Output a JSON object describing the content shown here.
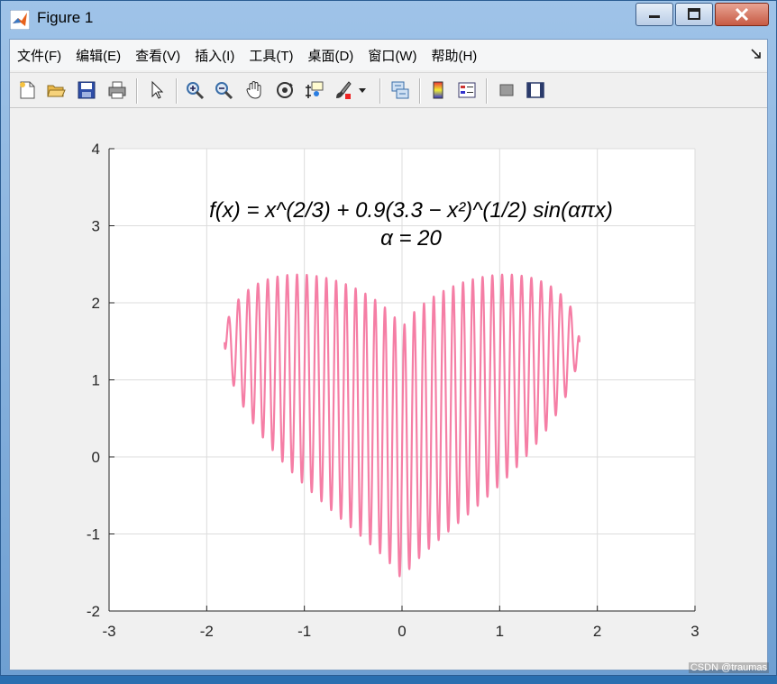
{
  "window": {
    "title": "Figure 1",
    "buttons": [
      "minimize-icon",
      "maximize-icon",
      "close-icon"
    ]
  },
  "menu": {
    "items": [
      "文件(F)",
      "编辑(E)",
      "查看(V)",
      "插入(I)",
      "工具(T)",
      "桌面(D)",
      "窗口(W)",
      "帮助(H)"
    ]
  },
  "toolbar": {
    "buttons": [
      "new-figure-icon",
      "open-file-icon",
      "save-icon",
      "print-icon",
      "pointer-icon",
      "zoom-in-icon",
      "zoom-out-icon",
      "pan-hand-icon",
      "rotate-3d-icon",
      "data-cursor-icon",
      "brush-icon",
      "link-plot-icon",
      "colorbar-icon",
      "legend-icon",
      "hide-plot-tools-icon",
      "show-plot-tools-icon"
    ]
  },
  "watermark": "CSDN @traumas",
  "chart_data": {
    "type": "line",
    "title_line1": "f(x) = x^(2/3) + 0.9(3.3 − x²)^(1/2) sin(απx)",
    "title_line2": "α = 20",
    "function": {
      "alpha": 20,
      "x_min": -1.8166,
      "x_max": 1.8166
    },
    "xlim": [
      -3,
      3
    ],
    "ylim": [
      -2,
      4
    ],
    "xticks": [
      "-3",
      "-2",
      "-1",
      "0",
      "1",
      "2",
      "3"
    ],
    "yticks": [
      "-2",
      "-1",
      "0",
      "1",
      "2",
      "3",
      "4"
    ],
    "grid": true,
    "line_color": "#f57ea5"
  }
}
